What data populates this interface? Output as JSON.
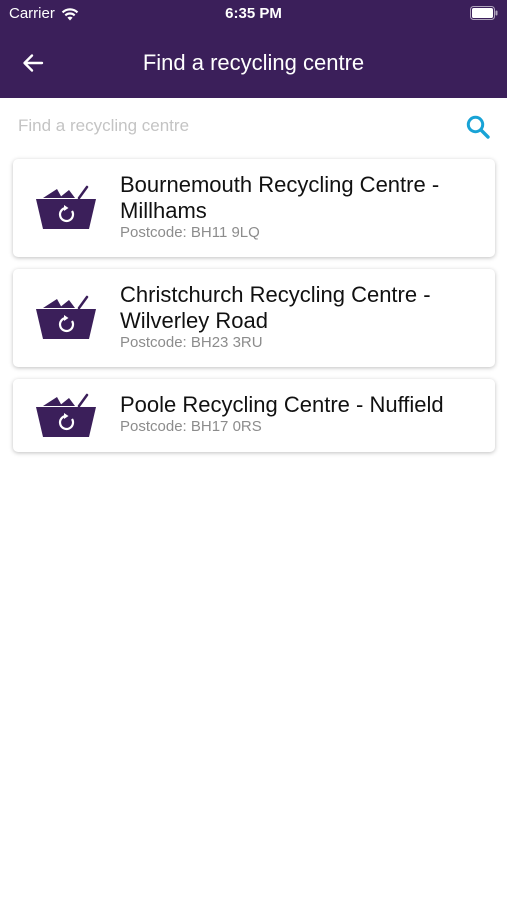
{
  "status_bar": {
    "carrier": "Carrier",
    "time": "6:35 PM"
  },
  "nav": {
    "title": "Find a recycling centre",
    "back_icon": "arrow-left-icon"
  },
  "search": {
    "placeholder": "Find a recycling centre",
    "value": "",
    "icon": "search-icon"
  },
  "centres": [
    {
      "name": "Bournemouth Recycling Centre - Millhams",
      "postcode": "Postcode: BH11 9LQ",
      "icon": "recycling-basket-icon"
    },
    {
      "name": "Christchurch Recycling Centre - Wilverley Road",
      "postcode": "Postcode: BH23 3RU",
      "icon": "recycling-basket-icon"
    },
    {
      "name": "Poole Recycling Centre - Nuffield",
      "postcode": "Postcode: BH17 0RS",
      "icon": "recycling-basket-icon"
    }
  ],
  "colors": {
    "header_bg": "#3b1f5a",
    "icon_purple": "#3b1f5a",
    "search_accent": "#18a3d6"
  }
}
